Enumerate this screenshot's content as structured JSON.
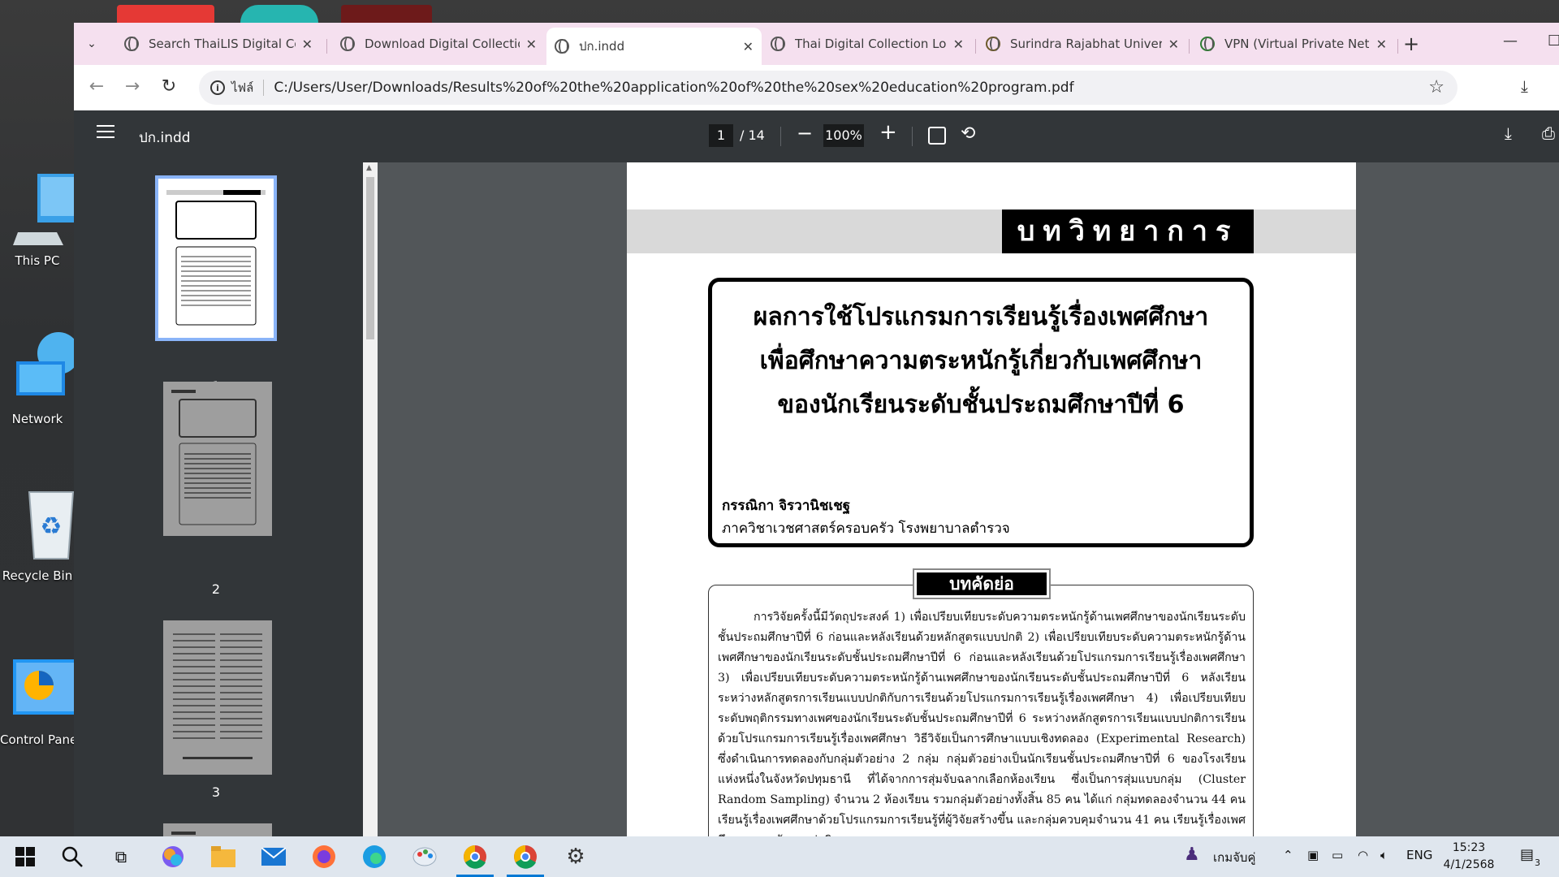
{
  "desktop": {
    "icons": [
      {
        "label": "This PC",
        "icon": "computer-icon"
      },
      {
        "label": "Network",
        "icon": "network-icon"
      },
      {
        "label": "Recycle Bin",
        "icon": "recycle-bin-icon"
      },
      {
        "label": "Control Panel",
        "icon": "control-panel-icon"
      }
    ]
  },
  "browser": {
    "tabs": [
      {
        "title": "Search ThaiLIS Digital Colle",
        "close": "✕"
      },
      {
        "title": "Download Digital Collectio",
        "close": "✕"
      },
      {
        "title": "ปก.indd",
        "close": "✕"
      },
      {
        "title": "Thai Digital Collection Log",
        "close": "✕"
      },
      {
        "title": "Surindra Rajabhat Universi",
        "close": "✕"
      },
      {
        "title": "VPN (Virtual Private Netwo",
        "close": "✕"
      }
    ],
    "new_tab": "+",
    "scheme_label": "ไฟล์",
    "url": "C:/Users/User/Downloads/Results%20of%20the%20application%20of%20the%20sex%20education%20program.pdf"
  },
  "pdf_toolbar": {
    "doc_title": "ปก.indd",
    "current_page": "1",
    "total_pages": "/ 14",
    "zoom": "100%"
  },
  "thumbnails": [
    {
      "number": "1"
    },
    {
      "number": "2"
    },
    {
      "number": "3"
    }
  ],
  "page": {
    "section_label": "บทวิทยาการ",
    "title_lines": [
      "ผลการใช้โปรแกรมการเรียนรู้เรื่องเพศศึกษา",
      "เพื่อศึกษาความตระหนักรู้เกี่ยวกับเพศศึกษา",
      "ของนักเรียนระดับชั้นประถมศึกษาปีที่ 6"
    ],
    "author": "กรรณิกา จิรวานิชเชฐ",
    "affiliation": "ภาควิชาเวชศาสตร์ครอบครัว โรงพยาบาลตำรวจ",
    "abstract_label": "บทคัดย่อ",
    "abstract_text": "การวิจัยครั้งนี้มีวัตถุประสงค์ 1) เพื่อเปรียบเทียบระดับความตระหนักรู้ด้านเพศศึกษาของนักเรียนระดับชั้นประถมศึกษาปีที่ 6 ก่อนและหลังเรียนด้วยหลักสูตรแบบปกติ 2) เพื่อเปรียบเทียบระดับความตระหนักรู้ด้านเพศศึกษาของนักเรียนระดับชั้นประถมศึกษาปีที่ 6 ก่อนและหลังเรียนด้วยโปรแกรมการเรียนรู้เรื่องเพศศึกษา 3) เพื่อเปรียบเทียบระดับความตระหนักรู้ด้านเพศศึกษาของนักเรียนระดับชั้นประถมศึกษาปีที่ 6 หลังเรียนระหว่างหลักสูตรการเรียนแบบปกติกับการเรียนด้วยโปรแกรมการเรียนรู้เรื่องเพศศึกษา 4) เพื่อเปรียบเทียบระดับพฤติกรรมทางเพศของนักเรียนระดับชั้นประถมศึกษาปีที่ 6 ระหว่างหลักสูตรการเรียนแบบปกติการเรียนด้วยโปรแกรมการเรียนรู้เรื่องเพศศึกษา วิธีวิจัยเป็นการศึกษาแบบเชิงทดลอง (Experimental Research) ซึ่งดำเนินการทดลองกับกลุ่มตัวอย่าง 2 กลุ่ม กลุ่มตัวอย่างเป็นนักเรียนชั้นประถมศึกษาปีที่ 6 ของโรงเรียนแห่งหนึ่งในจังหวัดปทุมธานี ที่ได้จากการสุ่มจับฉลากเลือกห้องเรียน ซึ่งเป็นการสุ่มแบบกลุ่ม (Cluster Random Sampling) จำนวน 2 ห้องเรียน รวมกลุ่มตัวอย่างทั้งสิ้น 85 คน ได้แก่ กลุ่มทดลองจำนวน 44 คน เรียนรู้เรื่องเพศศึกษาด้วยโปรแกรมการเรียนรู้ที่ผู้วิจัยสร้างขึ้น และกลุ่มควบคุมจำนวน 41 คน เรียนรู้เรื่องเพศศึกษาตามหลักสูตรปกติ"
  },
  "taskbar": {
    "tray_text": "เกมจับคู่",
    "language": "ENG",
    "time": "15:23",
    "date": "4/1/2568",
    "notification_count": "3"
  }
}
